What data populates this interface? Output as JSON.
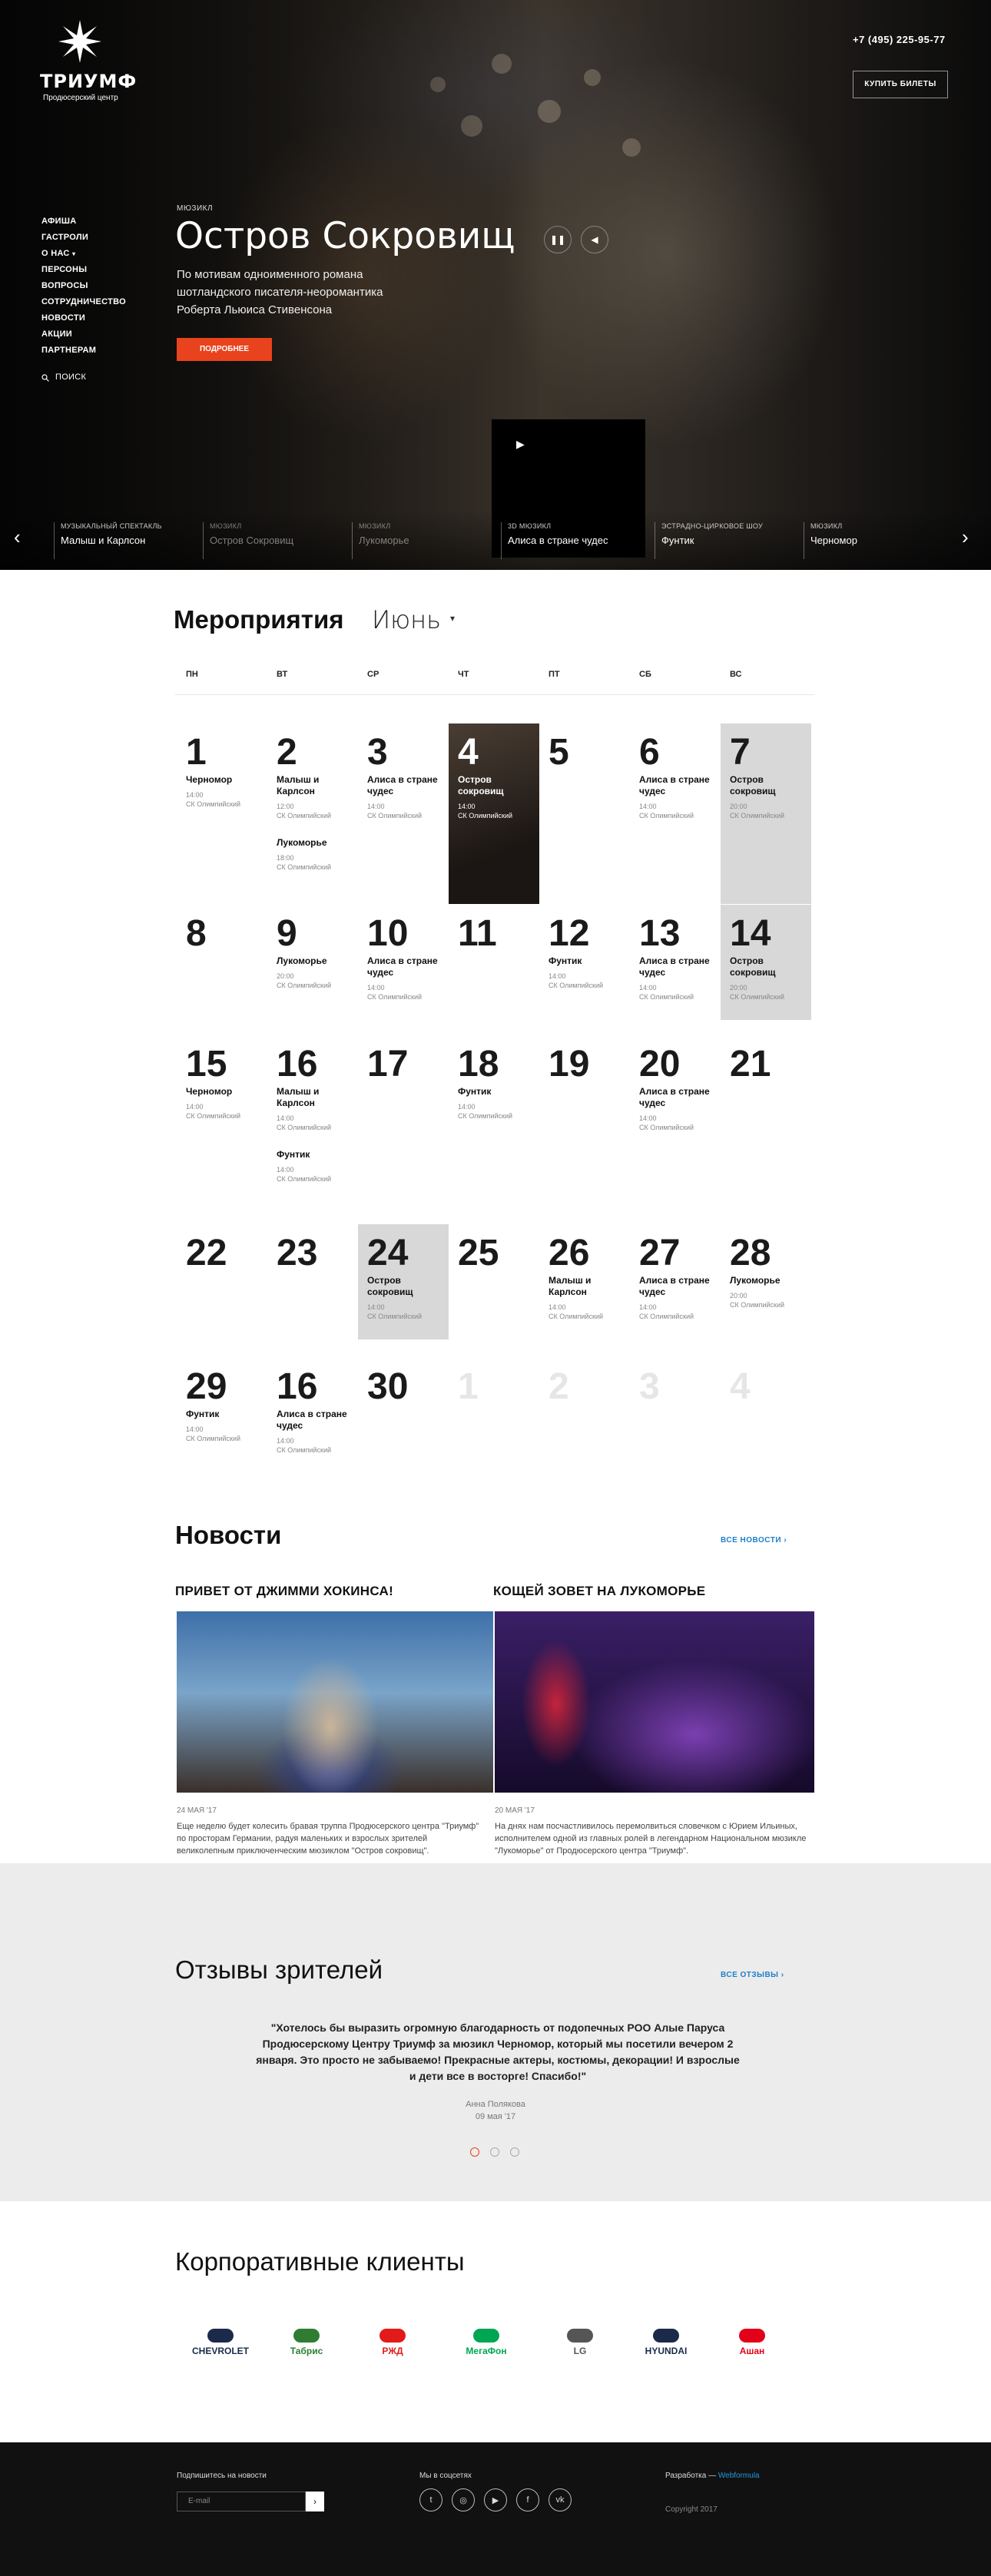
{
  "header": {
    "logo_name": "ТРИУМФ",
    "logo_sub": "Продюсерский центр",
    "phone": "+7 (495) 225-95-77",
    "buy_label": "КУПИТЬ БИЛЕТЫ"
  },
  "nav": {
    "items": [
      "АФИША",
      "ГАСТРОЛИ",
      "О НАС",
      "ПЕРСОНЫ",
      "ВОПРОСЫ",
      "СОТРУДНИЧЕСТВО",
      "НОВОСТИ",
      "АКЦИИ",
      "ПАРТНЕРАМ"
    ],
    "search_label": "ПОИСК"
  },
  "hero": {
    "genre": "МЮЗИКЛ",
    "title": "Остров Сокровищ",
    "description": "По мотивам одноименного романа шотландского писателя-неоромантика Роберта Льюиса Стивенсона",
    "more_label": "ПОДРОБНЕЕ",
    "strip": [
      {
        "genre": "МУЗЫКАЛЬНЫЙ СПЕКТАКЛЬ",
        "title": "Малыш и Карлсон"
      },
      {
        "genre": "МЮЗИКЛ",
        "title": "Остров Сокровищ"
      },
      {
        "genre": "МЮЗИКЛ",
        "title": "Лукоморье"
      },
      {
        "genre": "3D МЮЗИКЛ",
        "title": "Алиса в стране чудес"
      },
      {
        "genre": "ЭСТРАДНО-ЦИРКОВОЕ ШОУ",
        "title": "Фунтик"
      },
      {
        "genre": "МЮЗИКЛ",
        "title": "Черномор"
      }
    ]
  },
  "events": {
    "title": "Мероприятия",
    "month": "Июнь",
    "weekdays": [
      "ПН",
      "ВТ",
      "СР",
      "ЧТ",
      "ПТ",
      "СБ",
      "ВС"
    ],
    "place": "СК Олимпийский",
    "weeks": [
      [
        {
          "d": "1",
          "ev": [
            {
              "t": "Черномор",
              "time": "14:00"
            }
          ]
        },
        {
          "d": "2",
          "ev": [
            {
              "t": "Малыш и Карлсон",
              "time": "12:00"
            },
            {
              "t": "Лукоморье",
              "time": "18:00"
            }
          ]
        },
        {
          "d": "3",
          "ev": [
            {
              "t": "Алиса в стране чудес",
              "time": "14:00"
            }
          ]
        },
        {
          "d": "4",
          "dark": true,
          "ev": [
            {
              "t": "Остров сокровищ",
              "time": "14:00"
            }
          ]
        },
        {
          "d": "5",
          "ev": []
        },
        {
          "d": "6",
          "ev": [
            {
              "t": "Алиса в стране чудес",
              "time": "14:00"
            }
          ]
        },
        {
          "d": "7",
          "hl": true,
          "ev": [
            {
              "t": "Остров сокровищ",
              "time": "20:00"
            }
          ]
        }
      ],
      [
        {
          "d": "8",
          "ev": []
        },
        {
          "d": "9",
          "ev": [
            {
              "t": "Лукоморье",
              "time": "20:00"
            }
          ]
        },
        {
          "d": "10",
          "ev": [
            {
              "t": "Алиса в стране чудес",
              "time": "14:00"
            }
          ]
        },
        {
          "d": "11",
          "ev": []
        },
        {
          "d": "12",
          "ev": [
            {
              "t": "Фунтик",
              "time": "14:00"
            }
          ]
        },
        {
          "d": "13",
          "ev": [
            {
              "t": "Алиса в стране чудес",
              "time": "14:00"
            }
          ]
        },
        {
          "d": "14",
          "hl": true,
          "ev": [
            {
              "t": "Остров сокровищ",
              "time": "20:00"
            }
          ]
        }
      ],
      [
        {
          "d": "15",
          "ev": [
            {
              "t": "Черномор",
              "time": "14:00"
            }
          ]
        },
        {
          "d": "16",
          "ev": [
            {
              "t": "Малыш и Карлсон",
              "time": "14:00"
            },
            {
              "t": "Фунтик",
              "time": "14:00"
            }
          ]
        },
        {
          "d": "17",
          "ev": []
        },
        {
          "d": "18",
          "ev": [
            {
              "t": "Фунтик",
              "time": "14:00"
            }
          ]
        },
        {
          "d": "19",
          "ev": []
        },
        {
          "d": "20",
          "ev": [
            {
              "t": "Алиса в стране чудес",
              "time": "14:00"
            }
          ]
        },
        {
          "d": "21",
          "ev": []
        }
      ],
      [
        {
          "d": "22",
          "ev": []
        },
        {
          "d": "23",
          "ev": []
        },
        {
          "d": "24",
          "hl": true,
          "ev": [
            {
              "t": "Остров сокровищ",
              "time": "14:00"
            }
          ]
        },
        {
          "d": "25",
          "ev": []
        },
        {
          "d": "26",
          "ev": [
            {
              "t": "Малыш и Карлсон",
              "time": "14:00"
            }
          ]
        },
        {
          "d": "27",
          "ev": [
            {
              "t": "Алиса в стране чудес",
              "time": "14:00"
            }
          ]
        },
        {
          "d": "28",
          "ev": [
            {
              "t": "Лукоморье",
              "time": "20:00"
            }
          ]
        }
      ],
      [
        {
          "d": "29",
          "ev": [
            {
              "t": "Фунтик",
              "time": "14:00"
            }
          ]
        },
        {
          "d": "16",
          "ev": [
            {
              "t": "Алиса в стране чудес",
              "time": "14:00"
            }
          ]
        },
        {
          "d": "30",
          "ev": []
        },
        {
          "d": "1",
          "fade": true,
          "ev": []
        },
        {
          "d": "2",
          "fade": true,
          "ev": []
        },
        {
          "d": "3",
          "fade": true,
          "ev": []
        },
        {
          "d": "4",
          "fade": true,
          "ev": []
        }
      ]
    ]
  },
  "news": {
    "title": "Новости",
    "all_label": "ВСЕ НОВОСТИ",
    "items": [
      {
        "headline": "ПРИВЕТ ОТ ДЖИММИ ХОКИНСА!",
        "date": "24 МАЯ '17",
        "text": "Еще неделю будет колесить бравая труппа Продюсерского центра \"Триумф\" по просторам Германии, радуя маленьких и взрослых зрителей великолепным приключенческим мюзиклом \"Остров сокровищ\"."
      },
      {
        "headline": "КОЩЕЙ ЗОВЕТ НА ЛУКОМОРЬЕ",
        "date": "20 МАЯ '17",
        "text": "На днях нам посчастливилось перемолвиться словечком с Юрием Ильиных, исполнителем одной из главных ролей в легендарном Национальном мюзикле \"Лукоморье\" от Продюсерского центра \"Триумф\"."
      }
    ]
  },
  "reviews": {
    "title": "Отзывы зрителей",
    "all_label": "ВСЕ ОТЗЫВЫ",
    "quote": "\"Хотелось бы выразить огромную благодарность от подопечных РОО Алые Паруса Продюсерскому Центру Триумф за мюзикл Черномор, который мы посетили вечером 2 января. Это просто не забываемо! Прекрасные актеры, костюмы, декорации! И взрослые и дети все в восторге! Спасибо!\"",
    "author": "Анна Полякова",
    "date": "09 мая '17"
  },
  "clients": {
    "title": "Корпоративные клиенты",
    "logos": [
      {
        "name": "CHEVROLET",
        "color": "#1b2a4a"
      },
      {
        "name": "Табрис",
        "color": "#2e7d32"
      },
      {
        "name": "РЖД",
        "color": "#e21a1a"
      },
      {
        "name": "МегаФон",
        "color": "#00a651"
      },
      {
        "name": "LG",
        "color": "#555555"
      },
      {
        "name": "HYUNDAI",
        "color": "#1b2a4a"
      },
      {
        "name": "Ашан",
        "color": "#e2001a"
      }
    ]
  },
  "footer": {
    "subscribe_label": "Подпишитесь на новости",
    "email_placeholder": "E-mail",
    "social_label": "Мы в соцсетях",
    "dev_label": "Разработка —",
    "dev_link": "Webformula",
    "copyright": "Copyright 2017"
  },
  "colors": {
    "accent": "#e8431d",
    "link": "#1f7fc9",
    "footer_bg": "#111111",
    "reviews_bg": "#ececec"
  }
}
